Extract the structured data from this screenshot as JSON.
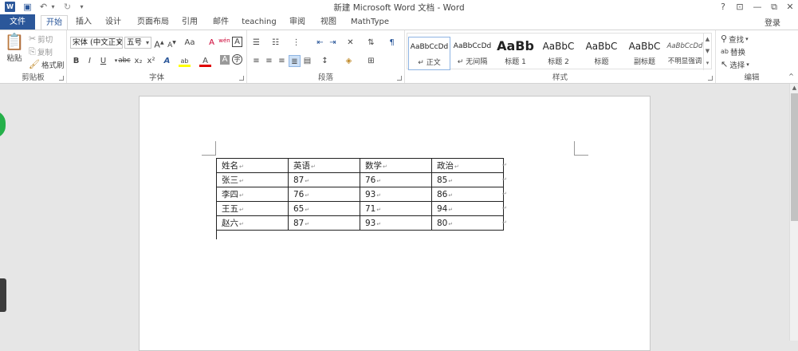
{
  "window": {
    "title": "新建 Microsoft Word 文档 - Word",
    "controls": {
      "help": "?",
      "ribbon_display": "⊡",
      "minimize": "—",
      "restore": "⧉",
      "close": "✕"
    }
  },
  "qat": {
    "word_logo": "W",
    "save": "💾",
    "undo": "↶",
    "undo_more": "▾",
    "redo": "↻",
    "customize": "▾"
  },
  "tabs": {
    "file": "文件",
    "home": "开始",
    "insert": "插入",
    "design": "设计",
    "layout": "页面布局",
    "references": "引用",
    "mailings": "邮件",
    "teaching": "teaching",
    "review": "审阅",
    "view": "视图",
    "mathtype": "MathType",
    "login": "登录"
  },
  "clipboard": {
    "paste": "粘贴",
    "cut": "剪切",
    "copy": "复制",
    "format_painter": "格式刷",
    "label": "剪贴板"
  },
  "font": {
    "name": "宋体 (中文正文",
    "size": "五号",
    "grow": "A",
    "shrink": "A",
    "case": "Aa",
    "clear": "A",
    "phonetic": "wén",
    "border": "A",
    "bold": "B",
    "italic": "I",
    "underline": "U",
    "strike": "abc",
    "sub": "x₂",
    "sup": "x²",
    "effects": "A",
    "highlight": "ab",
    "color": "A",
    "shade": "A",
    "circle": "字",
    "label": "字体"
  },
  "paragraph": {
    "label": "段落"
  },
  "styles": {
    "label": "样式",
    "items": [
      {
        "preview": "AaBbCcDd",
        "name": "↵ 正文"
      },
      {
        "preview": "AaBbCcDd",
        "name": "↵ 无间隔"
      },
      {
        "preview": "AaBb",
        "name": "标题 1"
      },
      {
        "preview": "AaBbC",
        "name": "标题 2"
      },
      {
        "preview": "AaBbC",
        "name": "标题"
      },
      {
        "preview": "AaBbC",
        "name": "副标题"
      },
      {
        "preview": "AaBbCcDd",
        "name": "不明显强调"
      }
    ]
  },
  "editing": {
    "find": "查找",
    "replace": "替换",
    "select": "选择",
    "label": "编辑"
  },
  "table": {
    "header": [
      "姓名",
      "英语",
      "数学",
      "政治"
    ],
    "rows": [
      [
        "张三",
        "87",
        "76",
        "85"
      ],
      [
        "李四",
        "76",
        "93",
        "86"
      ],
      [
        "王五",
        "65",
        "71",
        "94"
      ],
      [
        "赵六",
        "87",
        "93",
        "80"
      ]
    ],
    "mark": "↵"
  },
  "colors": {
    "accent": "#2b579a",
    "font_red": "#e00000",
    "highlight": "#ffff00"
  }
}
